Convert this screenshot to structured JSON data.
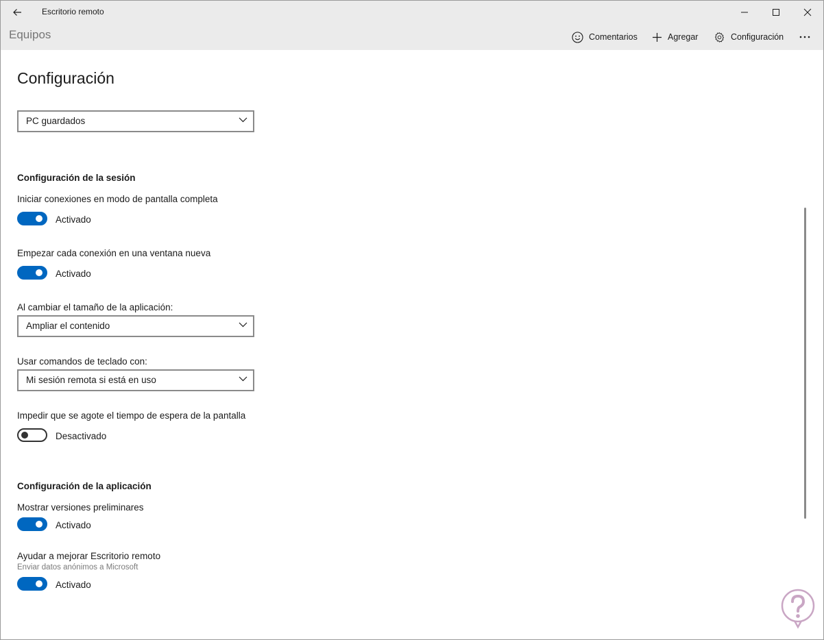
{
  "window": {
    "title": "Escritorio remoto"
  },
  "commandbar": {
    "section_title": "Equipos",
    "feedback_label": "Comentarios",
    "add_label": "Agregar",
    "settings_label": "Configuración"
  },
  "page": {
    "title": "Configuración",
    "saved_pcs_select": "PC guardados"
  },
  "session": {
    "heading": "Configuración de la sesión",
    "fullscreen": {
      "label": "Iniciar conexiones en modo de pantalla completa",
      "state": "Activado"
    },
    "new_window": {
      "label": "Empezar cada conexión en una ventana nueva",
      "state": "Activado"
    },
    "resize": {
      "label": "Al cambiar el tamaño de la aplicación:",
      "value": "Ampliar el contenido"
    },
    "keyboard": {
      "label": "Usar comandos de teclado con:",
      "value": "Mi sesión remota si está en uso"
    },
    "timeout": {
      "label": "Impedir que se agote el tiempo de espera de la pantalla",
      "state": "Desactivado"
    }
  },
  "app": {
    "heading": "Configuración de la aplicación",
    "preview": {
      "label": "Mostrar versiones preliminares",
      "state": "Activado"
    },
    "improve": {
      "label": "Ayudar a mejorar Escritorio remoto",
      "sublabel": "Enviar datos anónimos a Microsoft",
      "state": "Activado"
    }
  },
  "colors": {
    "accent": "#0067c0",
    "titlebar": "#ebebeb",
    "watermark": "#c9a6c4"
  }
}
